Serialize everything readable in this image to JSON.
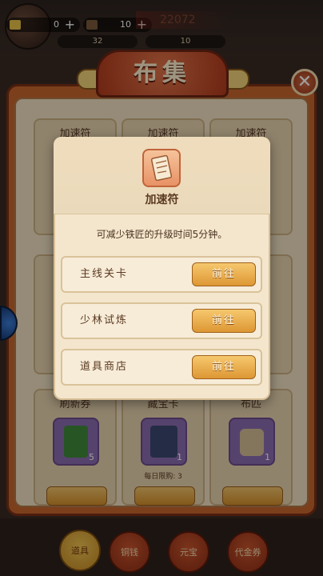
{
  "top_bar": {
    "resource1_value": "0",
    "resource2_value": "10",
    "power_value": "22072",
    "sub_value1": "32",
    "sub_value2": "10"
  },
  "market": {
    "title": "布集",
    "cards_row1": [
      {
        "title": "加速符"
      },
      {
        "title": "加速符"
      },
      {
        "title": "加速符"
      }
    ],
    "cards_row3": [
      {
        "title": "刷新券",
        "qty": "5"
      },
      {
        "title": "藏宝卡",
        "qty": "1",
        "limit": "每日限购: 3"
      },
      {
        "title": "布匹",
        "qty": "1"
      }
    ]
  },
  "bottom_tabs": [
    {
      "label": "道具",
      "active": true
    },
    {
      "label": "铜钱",
      "active": false
    },
    {
      "label": "元宝",
      "active": false
    },
    {
      "label": "代金券",
      "active": false
    }
  ],
  "modal": {
    "item_name": "加速符",
    "description": "可减少铁匠的升级时间5分钟。",
    "sources": [
      {
        "label": "主线关卡",
        "button": "前往"
      },
      {
        "label": "少林试炼",
        "button": "前往"
      },
      {
        "label": "道具商店",
        "button": "前往"
      }
    ]
  },
  "colors": {
    "frame": "#c9662e",
    "parchment": "#f1e1c2",
    "button_gold": "#dd9734",
    "modal_bg": "#f4e6cc"
  },
  "icons": [
    "plus-icon",
    "close-icon",
    "speed-talisman-icon",
    "gold-bar-icon"
  ]
}
